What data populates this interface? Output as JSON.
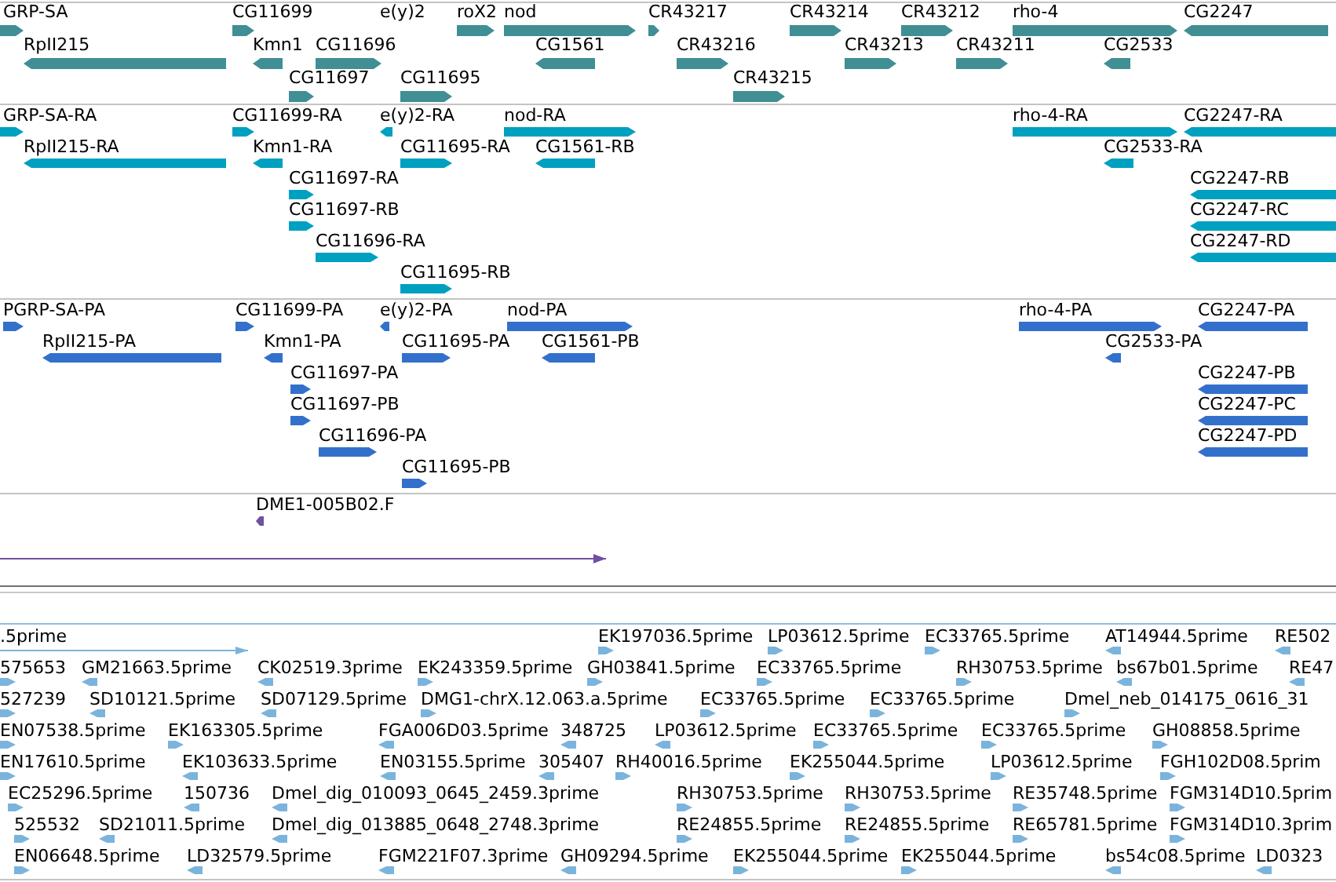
{
  "tracks": [
    {
      "kind": "gene",
      "features": [
        {
          "label": "GRP-SA",
          "reverse": false
        },
        {
          "label": "CG11699",
          "reverse": false
        },
        {
          "label": "e(y)2"
        },
        {
          "label": "roX2",
          "reverse": false
        },
        {
          "label": "nod",
          "reverse": false
        },
        {
          "label": "CR43217",
          "reverse": false
        },
        {
          "label": "CR43214",
          "reverse": false
        },
        {
          "label": "CR43212",
          "reverse": false
        },
        {
          "label": "rho-4",
          "reverse": false
        },
        {
          "label": "CG2247",
          "reverse": true
        },
        {
          "label": "RpII215",
          "reverse": true
        },
        {
          "label": "Kmn1",
          "reverse": true
        },
        {
          "label": "CG11696",
          "reverse": false
        },
        {
          "label": "CG1561",
          "reverse": true
        },
        {
          "label": "CR43216",
          "reverse": false
        },
        {
          "label": "CR43213",
          "reverse": false
        },
        {
          "label": "CR43211",
          "reverse": false
        },
        {
          "label": "CG2533",
          "reverse": true
        },
        {
          "label": "CG11697",
          "reverse": false
        },
        {
          "label": "CG11695",
          "reverse": false
        },
        {
          "label": "CR43215",
          "reverse": false
        }
      ]
    },
    {
      "kind": "transcript",
      "features": [
        {
          "label": "GRP-SA-RA",
          "reverse": false
        },
        {
          "label": "CG11699-RA",
          "reverse": false
        },
        {
          "label": "e(y)2-RA",
          "reverse": true
        },
        {
          "label": "nod-RA",
          "reverse": false
        },
        {
          "label": "rho-4-RA",
          "reverse": false
        },
        {
          "label": "CG2247-RA",
          "reverse": true
        },
        {
          "label": "RpII215-RA",
          "reverse": true
        },
        {
          "label": "Kmn1-RA",
          "reverse": true
        },
        {
          "label": "CG11695-RA",
          "reverse": false
        },
        {
          "label": "CG1561-RB",
          "reverse": true
        },
        {
          "label": "CG2533-RA",
          "reverse": true
        },
        {
          "label": "CG11697-RA",
          "reverse": false
        },
        {
          "label": "CG2247-RB",
          "reverse": true
        },
        {
          "label": "CG11697-RB",
          "reverse": false
        },
        {
          "label": "CG2247-RC",
          "reverse": true
        },
        {
          "label": "CG11696-RA",
          "reverse": false
        },
        {
          "label": "CG2247-RD",
          "reverse": true
        },
        {
          "label": "CG11695-RB",
          "reverse": false
        }
      ]
    },
    {
      "kind": "protein",
      "features": [
        {
          "label": "PGRP-SA-PA",
          "reverse": false
        },
        {
          "label": "CG11699-PA",
          "reverse": false
        },
        {
          "label": "e(y)2-PA",
          "reverse": true
        },
        {
          "label": "nod-PA",
          "reverse": false
        },
        {
          "label": "rho-4-PA",
          "reverse": false
        },
        {
          "label": "CG2247-PA",
          "reverse": true
        },
        {
          "label": "RpII215-PA",
          "reverse": true
        },
        {
          "label": "Kmn1-PA",
          "reverse": true
        },
        {
          "label": "CG11695-PA",
          "reverse": false
        },
        {
          "label": "CG1561-PB",
          "reverse": true
        },
        {
          "label": "CG2533-PA",
          "reverse": true
        },
        {
          "label": "CG11697-PA",
          "reverse": false
        },
        {
          "label": "CG2247-PB",
          "reverse": true
        },
        {
          "label": "CG11697-PB",
          "reverse": false
        },
        {
          "label": "CG2247-PC",
          "reverse": true
        },
        {
          "label": "CG11696-PA",
          "reverse": false
        },
        {
          "label": "CG2247-PD",
          "reverse": true
        },
        {
          "label": "CG11695-PB",
          "reverse": false
        }
      ]
    },
    {
      "kind": "alignment",
      "features": [
        {
          "label": "DME1-005B02.F",
          "reverse": true
        },
        {
          "reverse": false
        }
      ]
    },
    {
      "kind": "est",
      "features": [
        {
          "label": ".5prime",
          "reverse": false
        },
        {
          "label": "EK197036.5prime",
          "reverse": false
        },
        {
          "label": "LP03612.5prime",
          "reverse": false
        },
        {
          "label": "EC33765.5prime",
          "reverse": false
        },
        {
          "label": "AT14944.5prime",
          "reverse": true
        },
        {
          "label": "RE502",
          "reverse": true
        },
        {
          "label": "575653",
          "reverse": false
        },
        {
          "label": "GM21663.5prime",
          "reverse": true
        },
        {
          "label": "CK02519.3prime",
          "reverse": true
        },
        {
          "label": "EK243359.5prime",
          "reverse": false
        },
        {
          "label": "GH03841.5prime",
          "reverse": false
        },
        {
          "label": "EC33765.5prime",
          "reverse": false
        },
        {
          "label": "RH30753.5prime",
          "reverse": false
        },
        {
          "label": "bs67b01.5prime",
          "reverse": true
        },
        {
          "label": "RE47",
          "reverse": true
        },
        {
          "label": "527239",
          "reverse": false
        },
        {
          "label": "SD10121.5prime",
          "reverse": true
        },
        {
          "label": "SD07129.5prime",
          "reverse": true
        },
        {
          "label": "DMG1-chrX.12.063.a.5prime",
          "reverse": false
        },
        {
          "label": "EC33765.5prime",
          "reverse": false
        },
        {
          "label": "EC33765.5prime",
          "reverse": false
        },
        {
          "label": "Dmel_neb_014175_0616_31",
          "reverse": false
        },
        {
          "label": "EN07538.5prime",
          "reverse": false
        },
        {
          "label": "EK163305.5prime",
          "reverse": false
        },
        {
          "label": "FGA006D03.5prime",
          "reverse": true
        },
        {
          "label": "348725",
          "reverse": true
        },
        {
          "label": "LP03612.5prime",
          "reverse": true
        },
        {
          "label": "EC33765.5prime",
          "reverse": false
        },
        {
          "label": "EC33765.5prime",
          "reverse": false
        },
        {
          "label": "GH08858.5prime",
          "reverse": false
        },
        {
          "label": "EN17610.5prime",
          "reverse": false
        },
        {
          "label": "EK103633.5prime",
          "reverse": true
        },
        {
          "label": "EN03155.5prime",
          "reverse": true
        },
        {
          "label": "305407",
          "reverse": true
        },
        {
          "label": "RH40016.5prime",
          "reverse": false
        },
        {
          "label": "EK255044.5prime",
          "reverse": false
        },
        {
          "label": "LP03612.5prime",
          "reverse": false
        },
        {
          "label": "FGH102D08.5prim",
          "reverse": false
        },
        {
          "label": "EC25296.5prime",
          "reverse": false
        },
        {
          "label": "150736",
          "reverse": true
        },
        {
          "label": "Dmel_dig_010093_0645_2459.3prime",
          "reverse": true
        },
        {
          "label": "RH30753.5prime",
          "reverse": false
        },
        {
          "label": "RH30753.5prime",
          "reverse": false
        },
        {
          "label": "RE35748.5prime",
          "reverse": false
        },
        {
          "label": "FGM314D10.5prim",
          "reverse": false
        },
        {
          "label": "525532",
          "reverse": false
        },
        {
          "label": "SD21011.5prime",
          "reverse": true
        },
        {
          "label": "Dmel_dig_013885_0648_2748.3prime",
          "reverse": true
        },
        {
          "label": "RE24855.5prime",
          "reverse": false
        },
        {
          "label": "RE24855.5prime",
          "reverse": false
        },
        {
          "label": "RE65781.5prime",
          "reverse": false
        },
        {
          "label": "FGM314D10.3prim",
          "reverse": false
        },
        {
          "label": "EN06648.5prime",
          "reverse": false
        },
        {
          "label": "LD32579.5prime",
          "reverse": true
        },
        {
          "label": "FGM221F07.3prime",
          "reverse": true
        },
        {
          "label": "GH09294.5prime",
          "reverse": true
        },
        {
          "label": "EK255044.5prime",
          "reverse": false
        },
        {
          "label": "EK255044.5prime",
          "reverse": false
        },
        {
          "label": "bs54c08.5prime",
          "reverse": true
        },
        {
          "label": "LD0323",
          "reverse": true
        }
      ]
    }
  ]
}
